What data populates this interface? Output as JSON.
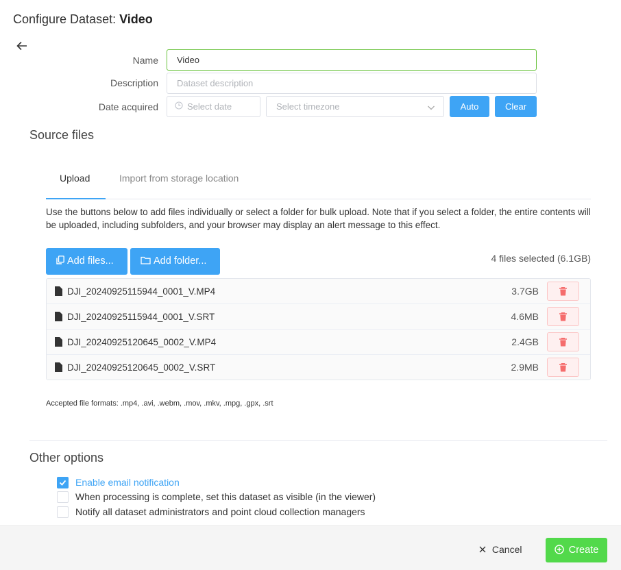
{
  "header": {
    "title_prefix": "Configure Dataset: ",
    "title_name": "Video"
  },
  "form": {
    "name_label": "Name",
    "name_value": "Video",
    "description_label": "Description",
    "description_placeholder": "Dataset description",
    "date_label": "Date acquired",
    "date_placeholder": "Select date",
    "timezone_placeholder": "Select timezone",
    "auto_label": "Auto",
    "clear_label": "Clear"
  },
  "source": {
    "heading": "Source files",
    "tabs": [
      {
        "label": "Upload",
        "active": true
      },
      {
        "label": "Import from storage location",
        "active": false
      }
    ],
    "info": "Use the buttons below to add files individually or select a folder for bulk upload. Note that if you select a folder, the entire contents will be uploaded, including subfolders, and your browser may display an alert message to this effect.",
    "add_files_label": "Add files...",
    "add_folder_label": "Add folder...",
    "files_selected": "4 files selected (6.1GB)",
    "files": [
      {
        "name": "DJI_20240925115944_0001_V.MP4",
        "size": "3.7GB"
      },
      {
        "name": "DJI_20240925115944_0001_V.SRT",
        "size": "4.6MB"
      },
      {
        "name": "DJI_20240925120645_0002_V.MP4",
        "size": "2.4GB"
      },
      {
        "name": "DJI_20240925120645_0002_V.SRT",
        "size": "2.9MB"
      }
    ],
    "accepted_formats": "Accepted file formats: .mp4, .avi, .webm, .mov, .mkv, .mpg, .gpx, .srt"
  },
  "options": {
    "heading": "Other options",
    "items": [
      {
        "label": "Enable email notification",
        "checked": true
      },
      {
        "label": "When processing is complete, set this dataset as visible (in the viewer)",
        "checked": false
      },
      {
        "label": "Notify all dataset administrators and point cloud collection managers",
        "checked": false
      }
    ]
  },
  "footer": {
    "cancel_label": "Cancel",
    "create_label": "Create"
  },
  "colors": {
    "accent": "#3ea4f5",
    "success": "#52d94b",
    "danger": "#f56c6c"
  }
}
